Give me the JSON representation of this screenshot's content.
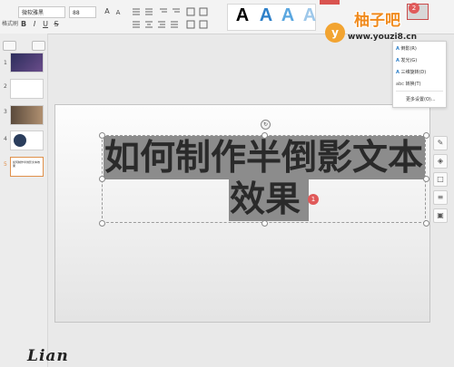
{
  "ribbon": {
    "font_name": "微软雅黑",
    "font_size": "88",
    "bold": "B",
    "italic": "I",
    "underline": "U",
    "strike": "S",
    "grow_font": "A",
    "shrink_font": "A",
    "format_label": "格式刷",
    "wordart_styles": [
      {
        "glyph": "A",
        "color": "#1b1b1b"
      },
      {
        "glyph": "A",
        "color": "#2e80c9"
      },
      {
        "glyph": "A",
        "color": "#5aa7e0"
      },
      {
        "glyph": "A",
        "color": "#9ec8ea"
      }
    ]
  },
  "thumbnails": [
    {
      "num": "1",
      "title": ""
    },
    {
      "num": "2",
      "title": ""
    },
    {
      "num": "3",
      "title": ""
    },
    {
      "num": "4",
      "title": ""
    },
    {
      "num": "5",
      "title": "如何制作半倒影文本效果"
    }
  ],
  "slide": {
    "title_line1": "如何制作半倒影文本",
    "title_line2": "效果",
    "badge": "1"
  },
  "dropdown": {
    "items": [
      {
        "icon": "A",
        "label": "倒影(R)"
      },
      {
        "icon": "A",
        "label": "发光(G)"
      },
      {
        "icon": "A",
        "label": "三维旋转(D)"
      },
      {
        "icon": "abc",
        "label": "转换(T)"
      },
      {
        "icon": "",
        "label": "更多设置(O)..."
      }
    ]
  },
  "badges": {
    "top_right": "2"
  },
  "watermark": {
    "logo_letter": "y",
    "title": "柚子吧",
    "url": "www.youzi8.cn"
  },
  "signature": "Lian"
}
